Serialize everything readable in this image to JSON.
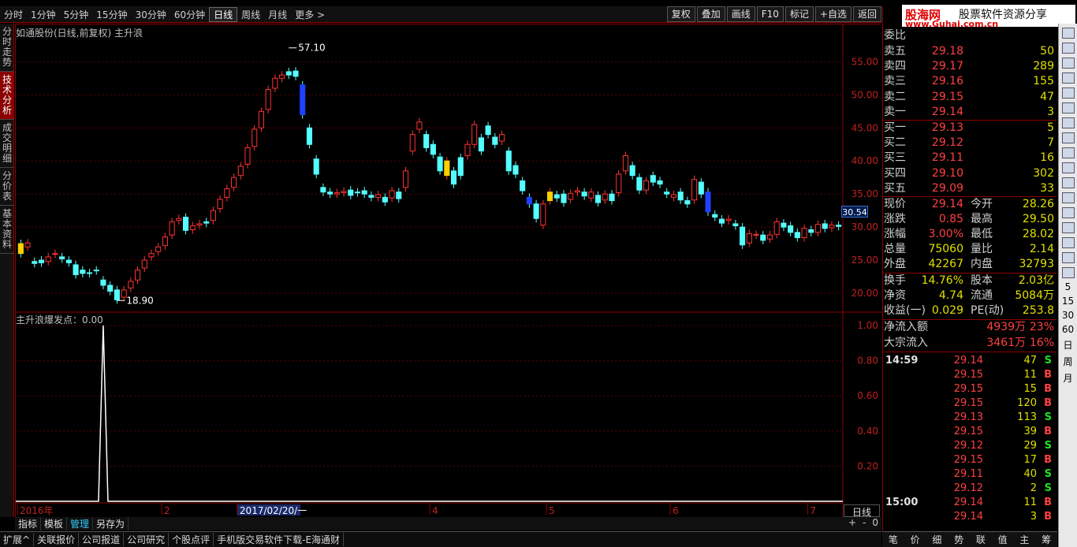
{
  "periods": [
    "分时",
    "1分钟",
    "5分钟",
    "15分钟",
    "30分钟",
    "60分钟",
    "日线",
    "周线",
    "月线",
    "更多 >"
  ],
  "active_period": "日线",
  "tools": [
    "复权",
    "叠加",
    "画线",
    "F10",
    "标记",
    "+自选",
    "返回"
  ],
  "left_tabs": [
    "分时走势",
    "技术分析",
    "成交明细",
    "分价表",
    "基本资料"
  ],
  "active_left_tab": "技术分析",
  "chart_title": "如通股份(日线,前复权) 主升浪",
  "price_tag": "30.54",
  "ind_title": "主升浪爆发点：0.00",
  "day_label": "日线",
  "high_label": "57.10",
  "low_label": "18.90",
  "date_highlight": "2017/02/20/一",
  "bottom_tabs": [
    "指标",
    "模板",
    "管理",
    "另存为"
  ],
  "active_bottom_tab": "管理",
  "zoom": [
    "+",
    "-",
    "0"
  ],
  "footer": [
    "扩展^",
    "关联报价",
    "公司报道",
    "公司研究",
    "个股点评",
    "手机版交易软件下载-E海通财"
  ],
  "logo": {
    "l1": "股海网",
    "l2": "股票软件资源分享",
    "l3": "www.Guhai.com.cn"
  },
  "quote": {
    "weibi": "委比",
    "sell": [
      [
        "卖五",
        "29.18",
        "50"
      ],
      [
        "卖四",
        "29.17",
        "289"
      ],
      [
        "卖三",
        "29.16",
        "155"
      ],
      [
        "卖二",
        "29.15",
        "47"
      ],
      [
        "卖一",
        "29.14",
        "3"
      ]
    ],
    "buy": [
      [
        "买一",
        "29.13",
        "5"
      ],
      [
        "买二",
        "29.12",
        "7"
      ],
      [
        "买三",
        "29.11",
        "16"
      ],
      [
        "买四",
        "29.10",
        "302"
      ],
      [
        "买五",
        "29.09",
        "33"
      ]
    ],
    "stats": [
      [
        "现价",
        "29.14",
        "今开",
        "28.26"
      ],
      [
        "涨跌",
        "0.85",
        "最高",
        "29.50"
      ],
      [
        "涨幅",
        "3.00%",
        "最低",
        "28.02"
      ],
      [
        "总量",
        "75060",
        "量比",
        "2.14"
      ],
      [
        "外盘",
        "42267",
        "内盘",
        "32793"
      ]
    ],
    "stats2": [
      [
        "换手",
        "14.76%",
        "股本",
        "2.03亿"
      ],
      [
        "净资",
        "4.74",
        "流通",
        "5084万"
      ],
      [
        "收益(一)",
        "0.029",
        "PE(动)",
        "253.8"
      ]
    ],
    "flow": [
      [
        "净流入额",
        "4939万",
        "23%"
      ],
      [
        "大宗流入",
        "3461万",
        "16%"
      ]
    ]
  },
  "trades": [
    [
      "14:59",
      "29.14",
      "47",
      "S"
    ],
    [
      "",
      "29.15",
      "11",
      "B"
    ],
    [
      "",
      "29.15",
      "15",
      "B"
    ],
    [
      "",
      "29.15",
      "120",
      "B"
    ],
    [
      "",
      "29.13",
      "113",
      "S"
    ],
    [
      "",
      "29.15",
      "39",
      "B"
    ],
    [
      "",
      "29.12",
      "29",
      "S"
    ],
    [
      "",
      "29.15",
      "17",
      "B"
    ],
    [
      "",
      "29.11",
      "40",
      "S"
    ],
    [
      "",
      "29.12",
      "2",
      "S"
    ],
    [
      "15:00",
      "29.14",
      "11",
      "B"
    ],
    [
      "",
      "29.14",
      "3",
      "B"
    ]
  ],
  "right_bottom": [
    "笔",
    "价",
    "细",
    "势",
    "联",
    "值",
    "主",
    "筹"
  ],
  "side_captions": [
    "5",
    "15",
    "30",
    "60",
    "日",
    "周",
    "月"
  ],
  "chart_data": {
    "type": "candlestick",
    "y_ticks": [
      "55.00",
      "50.00",
      "45.00",
      "40.00",
      "35.00",
      "30.00",
      "25.00",
      "20.00"
    ],
    "ylim": [
      17.5,
      58.5
    ],
    "ind_ticks": [
      "1.00",
      "0.80",
      "0.60",
      "0.40",
      "0.20"
    ],
    "x_labels": [
      "2016年",
      "2",
      "2017/02/20/一",
      "4",
      "5",
      "6",
      "7"
    ],
    "x_label_index": [
      0,
      21,
      32,
      60,
      77,
      95,
      115
    ],
    "count": 120,
    "signal_index": 12,
    "candles": [
      [
        27.5,
        26.0
      ],
      [
        27.0,
        27.6
      ],
      [
        24.8,
        24.5
      ],
      [
        25.0,
        24.6
      ],
      [
        24.8,
        25.5
      ],
      [
        25.9,
        26.0
      ],
      [
        25.5,
        25.2
      ],
      [
        25.0,
        24.6
      ],
      [
        24.3,
        22.8
      ],
      [
        23.5,
        23.0
      ],
      [
        23.1,
        23.0
      ],
      [
        23.5,
        23.4
      ],
      [
        22.0,
        21.2
      ],
      [
        21.2,
        20.3
      ],
      [
        20.5,
        19.0
      ],
      [
        19.4,
        20.5
      ],
      [
        20.8,
        21.8
      ],
      [
        22.0,
        23.5
      ],
      [
        23.8,
        25.0
      ],
      [
        25.5,
        26.0
      ],
      [
        26.3,
        27.0
      ],
      [
        27.2,
        28.5
      ],
      [
        28.8,
        30.8
      ],
      [
        31.0,
        31.3
      ],
      [
        31.5,
        29.5
      ],
      [
        29.6,
        30.2
      ],
      [
        30.3,
        30.5
      ],
      [
        30.8,
        30.6
      ],
      [
        31.0,
        32.5
      ],
      [
        32.8,
        34.2
      ],
      [
        34.5,
        35.8
      ],
      [
        36.0,
        37.5
      ],
      [
        37.8,
        39.2
      ],
      [
        39.5,
        42.0
      ],
      [
        42.2,
        44.8
      ],
      [
        45.0,
        47.5
      ],
      [
        47.8,
        50.8
      ],
      [
        51.0,
        52.5
      ],
      [
        52.5,
        53.0
      ],
      [
        53.5,
        53.0
      ],
      [
        53.6,
        52.8
      ],
      [
        51.5,
        47.0
      ],
      [
        45.0,
        42.5
      ],
      [
        40.3,
        38.0
      ],
      [
        36.0,
        35.3
      ],
      [
        35.3,
        35.0
      ],
      [
        35.0,
        35.2
      ],
      [
        35.2,
        35.4
      ],
      [
        35.6,
        34.8
      ],
      [
        35.3,
        35.2
      ],
      [
        35.5,
        35.0
      ],
      [
        34.8,
        34.5
      ],
      [
        34.5,
        34.9
      ],
      [
        34.5,
        33.8
      ],
      [
        34.4,
        35.5
      ],
      [
        35.3,
        34.3
      ],
      [
        36.0,
        38.5
      ],
      [
        41.5,
        44.0
      ],
      [
        44.8,
        45.9
      ],
      [
        44.0,
        42.0
      ],
      [
        42.5,
        41.0
      ],
      [
        40.6,
        38.5
      ],
      [
        37.8,
        40.0
      ],
      [
        38.5,
        36.5
      ],
      [
        40.5,
        37.8
      ],
      [
        40.8,
        42.5
      ],
      [
        42.5,
        45.5
      ],
      [
        43.5,
        41.5
      ],
      [
        45.3,
        44.0
      ],
      [
        43.6,
        42.5
      ],
      [
        43.0,
        44.0
      ],
      [
        41.5,
        38.5
      ],
      [
        39.3,
        38.0
      ],
      [
        37.0,
        35.5
      ],
      [
        34.5,
        33.5
      ],
      [
        33.5,
        31.3
      ],
      [
        30.3,
        33.5
      ],
      [
        34.0,
        35.3
      ],
      [
        34.9,
        34.4
      ],
      [
        35.0,
        33.7
      ],
      [
        34.2,
        35.1
      ],
      [
        35.3,
        35.5
      ],
      [
        35.3,
        34.7
      ],
      [
        34.4,
        35.3
      ],
      [
        34.8,
        33.7
      ],
      [
        34.1,
        35.0
      ],
      [
        35.0,
        34.0
      ],
      [
        35.2,
        38.0
      ],
      [
        38.5,
        40.8
      ],
      [
        39.3,
        37.8
      ],
      [
        37.5,
        35.6
      ],
      [
        35.6,
        37.0
      ],
      [
        37.8,
        36.8
      ],
      [
        37.0,
        36.5
      ],
      [
        35.3,
        35.0
      ],
      [
        34.5,
        34.9
      ],
      [
        35.3,
        34.1
      ],
      [
        34.0,
        33.5
      ],
      [
        34.1,
        37.2
      ],
      [
        36.8,
        35.0
      ],
      [
        35.3,
        32.3
      ],
      [
        31.9,
        31.5
      ],
      [
        31.2,
        30.6
      ],
      [
        31.0,
        31.2
      ],
      [
        30.5,
        30.2
      ],
      [
        30.0,
        27.3
      ],
      [
        27.6,
        29.0
      ],
      [
        28.8,
        28.9
      ],
      [
        28.8,
        28.0
      ],
      [
        28.2,
        28.8
      ],
      [
        28.9,
        30.8
      ],
      [
        30.6,
        30.0
      ],
      [
        30.2,
        29.2
      ],
      [
        29.2,
        28.4
      ],
      [
        28.4,
        29.8
      ],
      [
        29.6,
        29.2
      ],
      [
        29.2,
        30.4
      ],
      [
        30.5,
        29.8
      ],
      [
        29.9,
        30.3
      ],
      [
        30.3,
        30.1
      ]
    ]
  }
}
